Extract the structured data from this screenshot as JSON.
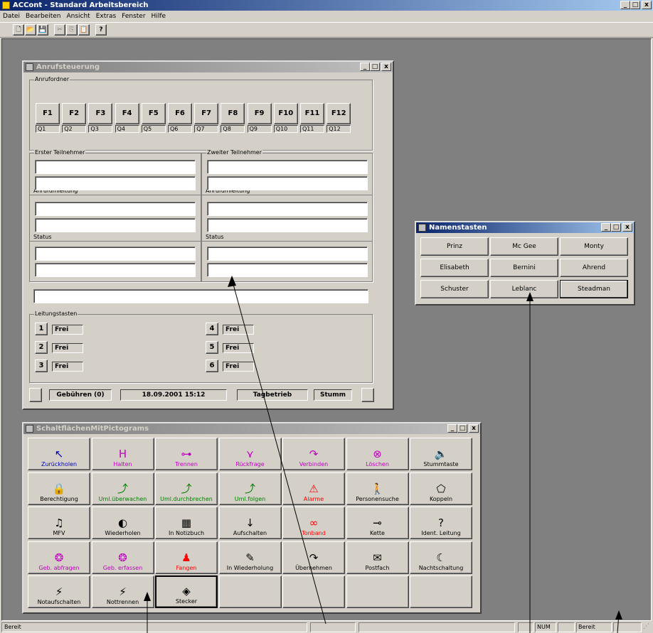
{
  "app": {
    "title": "ACCont - Standard Arbeitsbereich"
  },
  "menu": [
    "Datei",
    "Bearbeiten",
    "Ansicht",
    "Extras",
    "Fenster",
    "Hilfe"
  ],
  "window_controls": {
    "min": "_",
    "max": "□",
    "close": "x"
  },
  "toolbar": {
    "icons": [
      "new-file-icon",
      "open-folder-icon",
      "save-icon",
      "cut-icon",
      "copy-icon",
      "paste-icon",
      "help-icon"
    ],
    "glyphs": [
      "🗋",
      "📂",
      "💾",
      "✂",
      "⎘",
      "📋",
      "?"
    ]
  },
  "anruf": {
    "title": "Anrufsteuerung",
    "ordner_label": "Anrufordner",
    "fkeys": [
      "F1",
      "F2",
      "F3",
      "F4",
      "F5",
      "F6",
      "F7",
      "F8",
      "F9",
      "F10",
      "F11",
      "F12"
    ],
    "queues": [
      "Q1",
      "Q2",
      "Q3",
      "Q4",
      "Q5",
      "Q6",
      "Q7",
      "Q8",
      "Q9",
      "Q10",
      "Q11",
      "Q12"
    ],
    "erster": "Erster Teilnehmer",
    "zweiter": "Zweiter Teilnehmer",
    "umleitung_left": "Anrufumleitung",
    "umleitung_right": "Anrufumleitung",
    "status_left": "Status",
    "status_right": "Status",
    "leitung_label": "Leitungstasten",
    "lines": [
      {
        "num": "1",
        "state": "Frei"
      },
      {
        "num": "2",
        "state": "Frei"
      },
      {
        "num": "3",
        "state": "Frei"
      },
      {
        "num": "4",
        "state": "Frei"
      },
      {
        "num": "5",
        "state": "Frei"
      },
      {
        "num": "6",
        "state": "Frei"
      }
    ],
    "gebuehren": "Gebühren (0)",
    "datetime": "18.09.2001 15:12",
    "tagbetrieb": "Tagbetrieb",
    "stumm": "Stumm"
  },
  "namen": {
    "title": "Namenstasten",
    "names": [
      "Prinz",
      "Mc Gee",
      "Monty",
      "Elisabeth",
      "Bernini",
      "Ahrend",
      "Schuster",
      "Leblanc",
      "Steadman"
    ]
  },
  "pictos": {
    "title": "SchaltflächenMitPictograms",
    "buttons": [
      {
        "label": "Zurückholen",
        "color": "#0000c0",
        "icon": "↖"
      },
      {
        "label": "Halten",
        "color": "#c000c0",
        "icon": "H"
      },
      {
        "label": "Trennen",
        "color": "#c000c0",
        "icon": "⊶"
      },
      {
        "label": "Rückfrage",
        "color": "#c000c0",
        "icon": "⋎"
      },
      {
        "label": "Verbinden",
        "color": "#c000c0",
        "icon": "↷"
      },
      {
        "label": "Löschen",
        "color": "#c000c0",
        "icon": "⊗"
      },
      {
        "label": "Stummtaste",
        "color": "#000000",
        "icon": "🔈"
      },
      {
        "label": "Berechtigung",
        "color": "#000000",
        "icon": "🔒"
      },
      {
        "label": "Uml.überwachen",
        "color": "#008000",
        "icon": "⤴"
      },
      {
        "label": "Uml.durchbrechen",
        "color": "#008000",
        "icon": "⤴"
      },
      {
        "label": "Uml.folgen",
        "color": "#008000",
        "icon": "⤴"
      },
      {
        "label": "Alarme",
        "color": "#ff0000",
        "icon": "⚠"
      },
      {
        "label": "Personensuche",
        "color": "#000000",
        "icon": "🚶"
      },
      {
        "label": "Koppeln",
        "color": "#000000",
        "icon": "⬠"
      },
      {
        "label": "MFV",
        "color": "#000000",
        "icon": "♫"
      },
      {
        "label": "Wiederholen",
        "color": "#000000",
        "icon": "◐"
      },
      {
        "label": "In Notizbuch",
        "color": "#000000",
        "icon": "▦"
      },
      {
        "label": "Aufschalten",
        "color": "#000000",
        "icon": "↓"
      },
      {
        "label": "Tonband",
        "color": "#ff0000",
        "icon": "∞"
      },
      {
        "label": "Kette",
        "color": "#000000",
        "icon": "⊸"
      },
      {
        "label": "Ident. Leitung",
        "color": "#000000",
        "icon": "?"
      },
      {
        "label": "Geb. abfragen",
        "color": "#c000c0",
        "icon": "❂"
      },
      {
        "label": "Geb. erfassen",
        "color": "#c000c0",
        "icon": "❂"
      },
      {
        "label": "Fangen",
        "color": "#ff0000",
        "icon": "♟"
      },
      {
        "label": "In Wiederholung",
        "color": "#000000",
        "icon": "✎"
      },
      {
        "label": "Übernehmen",
        "color": "#000000",
        "icon": "↷"
      },
      {
        "label": "Postfach",
        "color": "#000000",
        "icon": "✉"
      },
      {
        "label": "Nachtschaltung",
        "color": "#000000",
        "icon": "☾"
      },
      {
        "label": "Notaufschalten",
        "color": "#000000",
        "icon": "⚡"
      },
      {
        "label": "Nottrennen",
        "color": "#000000",
        "icon": "⚡"
      },
      {
        "label": "Stecker",
        "color": "#000000",
        "icon": "◈"
      },
      {
        "label": "",
        "color": "#000000",
        "icon": ""
      },
      {
        "label": "",
        "color": "#000000",
        "icon": ""
      },
      {
        "label": "",
        "color": "#000000",
        "icon": ""
      },
      {
        "label": "",
        "color": "#000000",
        "icon": ""
      }
    ]
  },
  "statusbar": {
    "left": "Bereit",
    "num": "NUM",
    "right": "Bereit"
  }
}
